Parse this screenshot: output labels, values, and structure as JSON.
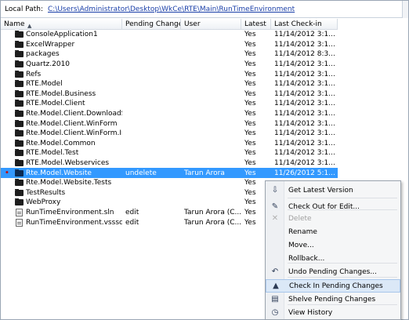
{
  "local_path": {
    "label": "Local Path:",
    "value": "C:\\Users\\Administrator\\Desktop\\WkCe\\RTE\\Main\\RunTimeEnvironment"
  },
  "columns": {
    "name": "Name",
    "pending": "Pending Change",
    "user": "User",
    "latest": "Latest",
    "checkin": "Last Check-in"
  },
  "rows": [
    {
      "name": "ConsoleApplication1",
      "pending": "",
      "user": "",
      "latest": "Yes",
      "checkin": "11/14/2012 3:1...",
      "kind": "folder"
    },
    {
      "name": "ExcelWrapper",
      "pending": "",
      "user": "",
      "latest": "Yes",
      "checkin": "11/14/2012 3:1...",
      "kind": "folder"
    },
    {
      "name": "packages",
      "pending": "",
      "user": "",
      "latest": "Yes",
      "checkin": "11/14/2012 8:3...",
      "kind": "folder"
    },
    {
      "name": "Quartz.2010",
      "pending": "",
      "user": "",
      "latest": "Yes",
      "checkin": "11/14/2012 3:1...",
      "kind": "folder"
    },
    {
      "name": "Refs",
      "pending": "",
      "user": "",
      "latest": "Yes",
      "checkin": "11/14/2012 3:1...",
      "kind": "folder"
    },
    {
      "name": "RTE.Model",
      "pending": "",
      "user": "",
      "latest": "Yes",
      "checkin": "11/14/2012 3:1...",
      "kind": "folder"
    },
    {
      "name": "RTE.Model.Business",
      "pending": "",
      "user": "",
      "latest": "Yes",
      "checkin": "11/14/2012 3:1...",
      "kind": "folder"
    },
    {
      "name": "RTE.Model.Client",
      "pending": "",
      "user": "",
      "latest": "Yes",
      "checkin": "11/14/2012 3:1...",
      "kind": "folder"
    },
    {
      "name": "Rte.Model.Client.DownloadSh...",
      "pending": "",
      "user": "",
      "latest": "Yes",
      "checkin": "11/14/2012 3:1...",
      "kind": "folder"
    },
    {
      "name": "Rte.Model.Client.WinForm",
      "pending": "",
      "user": "",
      "latest": "Yes",
      "checkin": "11/14/2012 3:1...",
      "kind": "folder"
    },
    {
      "name": "Rte.Model.Client.WinForm.Ins...",
      "pending": "",
      "user": "",
      "latest": "Yes",
      "checkin": "11/14/2012 3:1...",
      "kind": "folder"
    },
    {
      "name": "Rte.Model.Common",
      "pending": "",
      "user": "",
      "latest": "Yes",
      "checkin": "11/14/2012 3:1...",
      "kind": "folder"
    },
    {
      "name": "RTE.Model.Test",
      "pending": "",
      "user": "",
      "latest": "Yes",
      "checkin": "11/14/2012 3:1...",
      "kind": "folder"
    },
    {
      "name": "RTE.Model.Webservices",
      "pending": "",
      "user": "",
      "latest": "Yes",
      "checkin": "11/14/2012 3:1...",
      "kind": "folder"
    },
    {
      "name": "Rte.Model.Website",
      "pending": "undelete",
      "user": "Tarun Arora",
      "latest": "Yes",
      "checkin": "11/26/2012 5:1...",
      "kind": "folder",
      "selected": true,
      "pending_mark": true
    },
    {
      "name": "Rte.Model.Website.Tests",
      "pending": "",
      "user": "",
      "latest": "Yes",
      "checkin": "",
      "kind": "folder"
    },
    {
      "name": "TestResults",
      "pending": "",
      "user": "",
      "latest": "Yes",
      "checkin": "",
      "kind": "folder"
    },
    {
      "name": "WebProxy",
      "pending": "",
      "user": "",
      "latest": "Yes",
      "checkin": "",
      "kind": "folder"
    },
    {
      "name": "RunTimeEnvironment.sln",
      "pending": "edit",
      "user": "Tarun Arora (C...",
      "latest": "Yes",
      "checkin": "",
      "kind": "file"
    },
    {
      "name": "RunTimeEnvironment.vssscc",
      "pending": "edit",
      "user": "Tarun Arora (C...",
      "latest": "Yes",
      "checkin": "",
      "kind": "file"
    }
  ],
  "context_menu": {
    "items": [
      {
        "label": "Get Latest Version",
        "icon": "get-latest-icon",
        "glyph": "⇩"
      },
      {
        "label": "Check Out for Edit...",
        "icon": "checkout-icon",
        "glyph": "✎"
      },
      {
        "label": "Delete",
        "icon": "delete-icon",
        "glyph": "✕",
        "disabled": true
      },
      {
        "label": "Rename",
        "icon": "",
        "glyph": ""
      },
      {
        "label": "Move...",
        "icon": "",
        "glyph": ""
      },
      {
        "label": "Rollback...",
        "icon": "",
        "glyph": ""
      },
      {
        "label": "Undo Pending Changes...",
        "icon": "undo-icon",
        "glyph": "↶"
      },
      {
        "label": "Check In Pending Changes",
        "icon": "checkin-icon",
        "glyph": "▲",
        "hover": true
      },
      {
        "label": "Shelve Pending Changes",
        "icon": "shelve-icon",
        "glyph": "▤"
      },
      {
        "label": "View History",
        "icon": "history-icon",
        "glyph": "◷"
      }
    ]
  }
}
